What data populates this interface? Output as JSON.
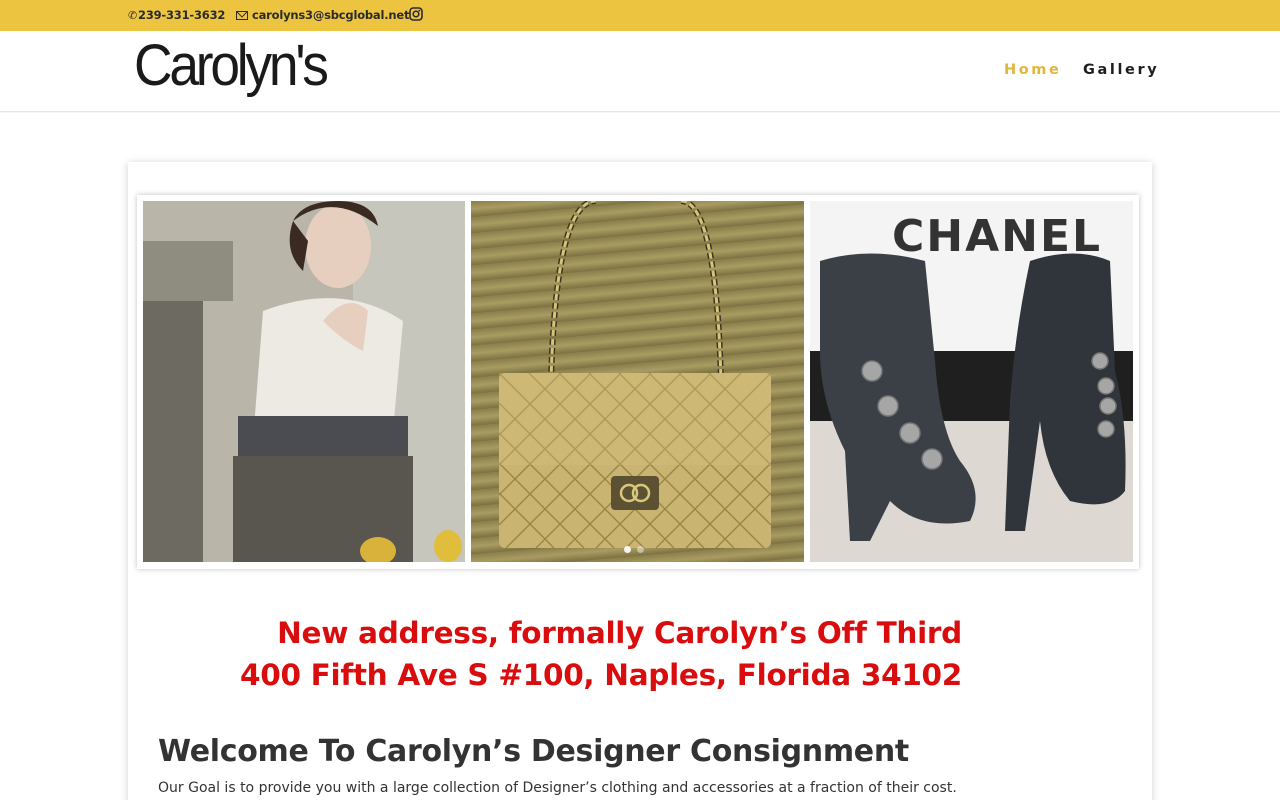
{
  "topbar": {
    "phone": "239-331-3632",
    "email": "carolyns3@sbcglobal.net",
    "background": "#ecc440"
  },
  "header": {
    "logo_text": "Carolyn's",
    "nav": [
      {
        "label": "Home",
        "active": true
      },
      {
        "label": "Gallery",
        "active": false
      }
    ],
    "accent": "#e0b63b"
  },
  "slider": {
    "panels": [
      {
        "description_icon": "model-photo"
      },
      {
        "description_icon": "gold-handbag-photo"
      },
      {
        "description_icon": "chanel-boots-photo",
        "brand_text": "CHANEL"
      }
    ],
    "dots": [
      true,
      false
    ]
  },
  "announcement": {
    "line1": "New address, formally Carolyn’s Off Third",
    "line2": "400 Fifth Ave S #100, Naples, Florida 34102",
    "color": "#d90d0d"
  },
  "main": {
    "heading": "Welcome To Carolyn’s Designer Consignment",
    "goal": "Our Goal is to provide you with a large collection of Designer’s clothing and accessories at a fraction of their cost."
  }
}
